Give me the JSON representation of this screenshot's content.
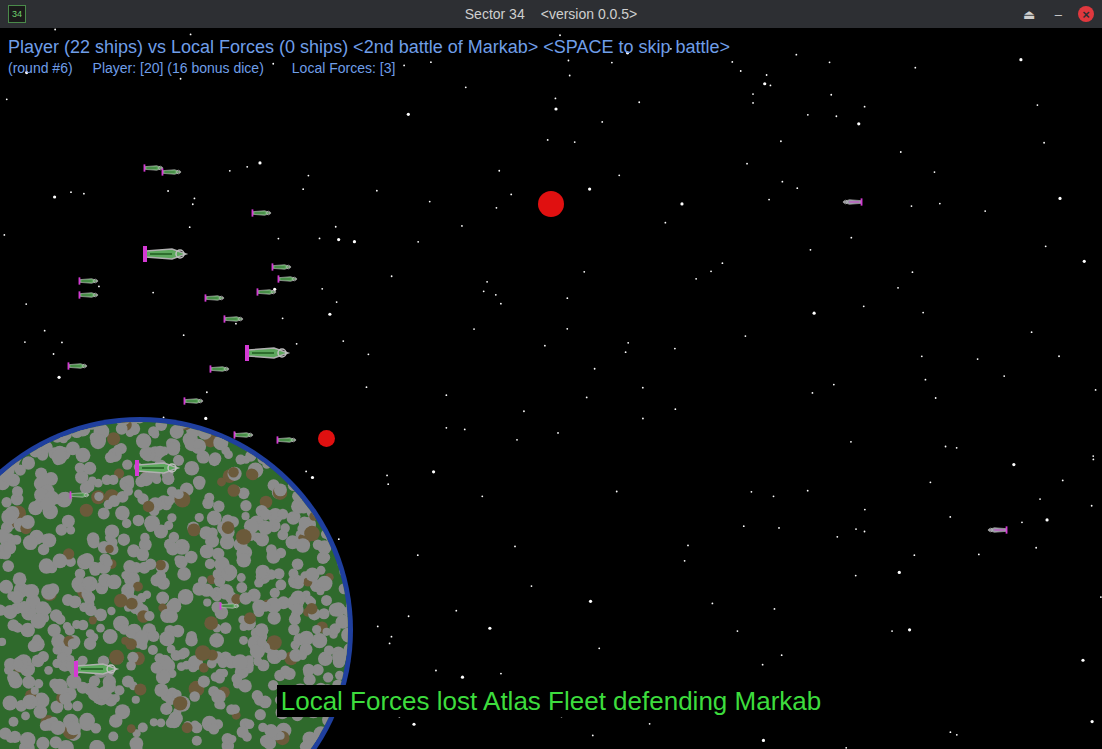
{
  "window": {
    "icon": "34",
    "title": "Sector 34",
    "version": "<version 0.0.5>",
    "buttons": [
      "⏏",
      "–",
      "×"
    ]
  },
  "battle": {
    "header": "Player (22 ships) vs Local Forces (0 ships) <2nd battle of Markab> <SPACE to skip battle>",
    "round": "(round #6)",
    "player": "Player: [20] (16 bonus dice)",
    "enemy": "Local Forces: [3]"
  },
  "message": "Local Forces lost Atlas Fleet defending Markab"
}
